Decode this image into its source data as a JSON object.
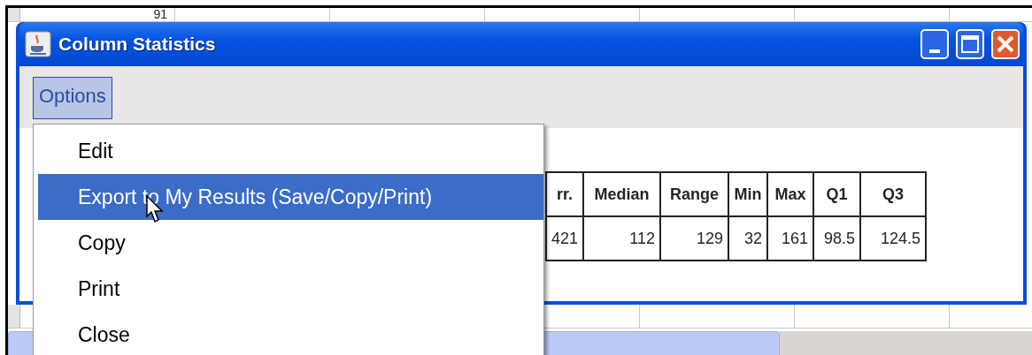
{
  "background_sheet": {
    "cell": "91"
  },
  "window": {
    "title": "Column Statistics"
  },
  "menu_bar": [
    {
      "label": "Options",
      "selected": true
    }
  ],
  "menu": {
    "items": [
      {
        "label": "Edit",
        "selected": false
      },
      {
        "label": "Export to My Results (Save/Copy/Print)",
        "selected": true
      },
      {
        "label": "Copy",
        "selected": false
      },
      {
        "label": "Print",
        "selected": false
      },
      {
        "label": "Close",
        "selected": false
      }
    ]
  },
  "table": {
    "columns": [
      "rr.",
      "Median",
      "Range",
      "Min",
      "Max",
      "Q1",
      "Q3"
    ],
    "rows": [
      [
        "421",
        "112",
        "129",
        "32",
        "161",
        "98.5",
        "124.5"
      ]
    ]
  }
}
